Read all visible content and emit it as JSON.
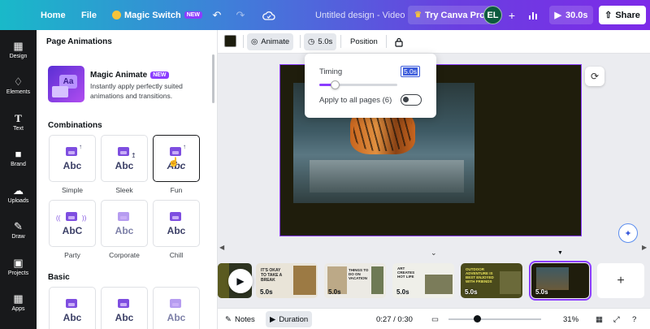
{
  "topbar": {
    "home": "Home",
    "file": "File",
    "magic_switch": "Magic Switch",
    "magic_switch_badge": "NEW",
    "title": "Untitled design - Video",
    "try_pro": "Try Canva Pro",
    "avatar_initials": "EL",
    "present_label": "30.0s",
    "share": "Share"
  },
  "rail": [
    {
      "label": "Design",
      "icon": "design-icon"
    },
    {
      "label": "Elements",
      "icon": "elements-icon"
    },
    {
      "label": "Text",
      "icon": "text-icon"
    },
    {
      "label": "Brand",
      "icon": "brand-icon"
    },
    {
      "label": "Uploads",
      "icon": "uploads-icon"
    },
    {
      "label": "Draw",
      "icon": "draw-icon"
    },
    {
      "label": "Projects",
      "icon": "projects-icon"
    },
    {
      "label": "Apps",
      "icon": "apps-icon"
    }
  ],
  "panel": {
    "title": "Page Animations",
    "magic_animate": {
      "title": "Magic Animate",
      "badge": "NEW",
      "description": "Instantly apply perfectly suited animations and transitions."
    },
    "combinations_heading": "Combinations",
    "combinations": [
      {
        "label": "Simple",
        "text": "Abc",
        "selected": false
      },
      {
        "label": "Sleek",
        "text": "Abc",
        "selected": false
      },
      {
        "label": "Fun",
        "text": "Abc",
        "selected": true
      },
      {
        "label": "Party",
        "text": "AbC",
        "selected": false
      },
      {
        "label": "Corporate",
        "text": "Abc",
        "selected": false
      },
      {
        "label": "Chill",
        "text": "Abc",
        "selected": false
      }
    ],
    "basic_heading": "Basic",
    "basic": [
      {
        "text": "Abc"
      },
      {
        "text": "Abc"
      },
      {
        "text": "Abc"
      }
    ]
  },
  "toolbar": {
    "animate": "Animate",
    "duration": "5.0s",
    "position": "Position"
  },
  "popover": {
    "timing_label": "Timing",
    "timing_value": "5.0s",
    "apply_all_label": "Apply to all pages (6)",
    "apply_all_on": false,
    "slider_fraction": 0.2
  },
  "timeline": {
    "clips": [
      {
        "duration": "",
        "theme": "dark"
      },
      {
        "duration": "5.0s",
        "theme": "light",
        "caption": "IT'S OKAY TO TAKE A BREAK"
      },
      {
        "duration": "5.0s",
        "theme": "light",
        "caption": "THINGS TO DO ON VACATION"
      },
      {
        "duration": "5.0s",
        "theme": "light",
        "caption": "ART CREATES HOT LIFE"
      },
      {
        "duration": "5.0s",
        "theme": "dark",
        "caption": "OUTDOOR ADVENTURE IS BEST ENJOYED WITH FRIENDS"
      },
      {
        "duration": "5.0s",
        "theme": "dark",
        "selected": true
      }
    ]
  },
  "bottombar": {
    "notes": "Notes",
    "duration": "Duration",
    "time": "0:27 / 0:30",
    "zoom": "31%"
  },
  "colors": {
    "accent": "#8b3dff",
    "page_background": "#1f1d0c"
  }
}
